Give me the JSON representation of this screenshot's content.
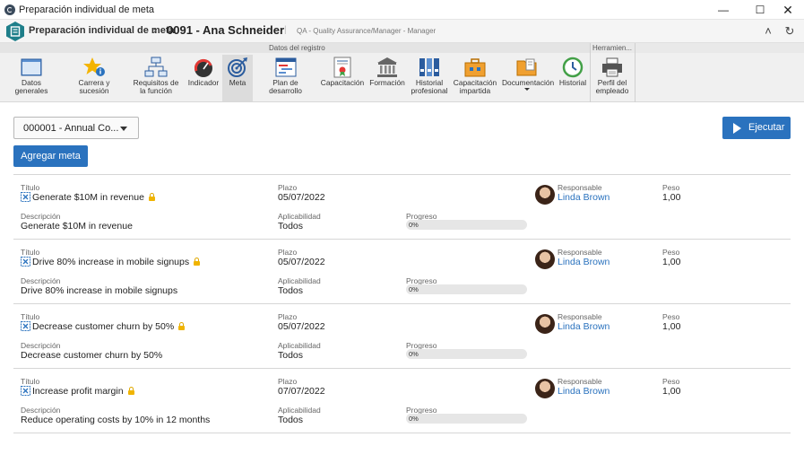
{
  "window": {
    "title": "Preparación individual de meta"
  },
  "header": {
    "breadcrumb": "Preparación individual de meta",
    "record": "0091 - Ana Schneider",
    "subtitle": "QA - Quality Assurance/Manager - Manager"
  },
  "ribbon": {
    "group_record": "Datos del registro",
    "group_tools": "Herramien...",
    "buttons": [
      {
        "label": "Datos generales",
        "icon": "window-icon"
      },
      {
        "label": "Carrera y sucesión",
        "icon": "star-info-icon"
      },
      {
        "label": "Requisitos de la función",
        "icon": "org-chart-icon"
      },
      {
        "label": "Indicador",
        "icon": "gauge-icon"
      },
      {
        "label": "Meta",
        "icon": "target-icon"
      },
      {
        "label": "Plan de desarrollo",
        "icon": "plan-icon"
      },
      {
        "label": "Capacitación",
        "icon": "certificate-icon"
      },
      {
        "label": "Formación",
        "icon": "institution-icon"
      },
      {
        "label": "Historial profesional",
        "icon": "binders-icon"
      },
      {
        "label": "Capacitación impartida",
        "icon": "briefcase-icon"
      },
      {
        "label": "Documentación",
        "icon": "folder-icon"
      },
      {
        "label": "Historial",
        "icon": "history-icon"
      },
      {
        "label": "Perfil del empleado",
        "icon": "printer-icon"
      }
    ]
  },
  "toolbar": {
    "select_value": "000001 - Annual Co...",
    "add_label": "Agregar meta",
    "execute_label": "Ejecutar"
  },
  "labels": {
    "title": "Título",
    "description": "Descripción",
    "deadline": "Plazo",
    "applicability": "Aplicabilidad",
    "progress": "Progreso",
    "responsible": "Responsable",
    "weight": "Peso"
  },
  "goals": [
    {
      "title": "Generate $10M in revenue",
      "description": "Generate $10M in revenue",
      "deadline": "05/07/2022",
      "applicability": "Todos",
      "progress": "0%",
      "progress_value": 0,
      "responsible": "Linda Brown",
      "weight": "1,00"
    },
    {
      "title": "Drive 80% increase in mobile signups",
      "description": "Drive 80% increase in mobile signups",
      "deadline": "05/07/2022",
      "applicability": "Todos",
      "progress": "0%",
      "progress_value": 0,
      "responsible": "Linda Brown",
      "weight": "1,00"
    },
    {
      "title": "Decrease customer churn by 50%",
      "description": "Decrease customer churn by 50%",
      "deadline": "05/07/2022",
      "applicability": "Todos",
      "progress": "0%",
      "progress_value": 0,
      "responsible": "Linda Brown",
      "weight": "1,00"
    },
    {
      "title": "Increase profit margin",
      "description": "Reduce operating costs by 10% in 12 months",
      "deadline": "07/07/2022",
      "applicability": "Todos",
      "progress": "0%",
      "progress_value": 0,
      "responsible": "Linda Brown",
      "weight": "1,00"
    }
  ],
  "colors": {
    "accent": "#2a72be",
    "lock": "#f0b400"
  }
}
